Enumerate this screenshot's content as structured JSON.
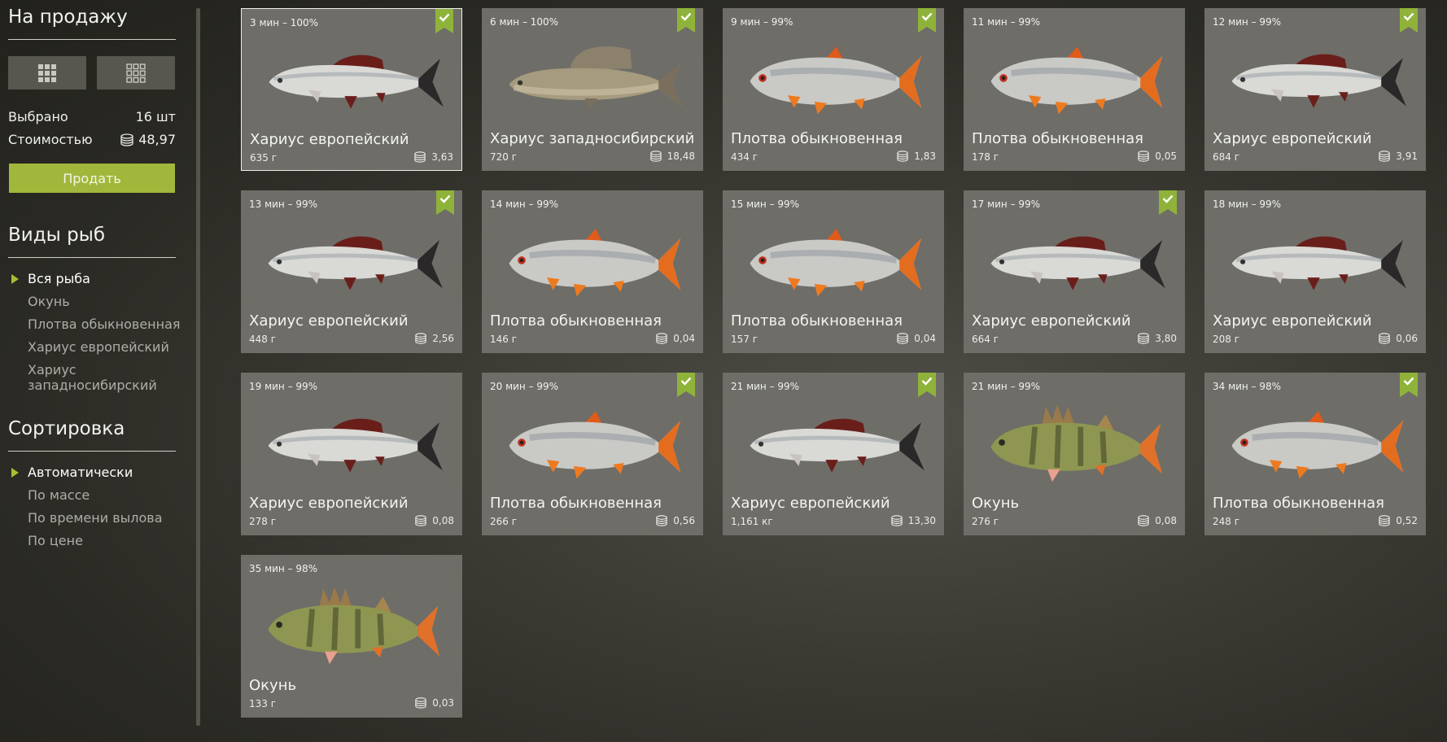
{
  "sidebar": {
    "title": "На продажу",
    "selected_label": "Выбрано",
    "selected_value": "16 шт",
    "cost_label": "Стоимостью",
    "cost_value": "48,97",
    "sell_label": "Продать",
    "species_title": "Виды рыб",
    "species": [
      "Вся рыба",
      "Окунь",
      "Плотва обыкновенная",
      "Хариус европейский",
      "Хариус западносибирский"
    ],
    "sort_title": "Сортировка",
    "sort": [
      "Автоматически",
      "По массе",
      "По времени вылова",
      "По цене"
    ]
  },
  "colors": {
    "accent": "#a1b73c",
    "card": "#6e6d68"
  },
  "cards": [
    {
      "time": "3 мин – 100%",
      "name": "Хариус европейский",
      "weight": "635 г",
      "price": "3,63",
      "fish": "grayling-eu",
      "checked": true,
      "selected": true
    },
    {
      "time": "6 мин – 100%",
      "name": "Хариус западносибирский",
      "weight": "720 г",
      "price": "18,48",
      "fish": "grayling-ws",
      "checked": true,
      "selected": false
    },
    {
      "time": "9 мин – 99%",
      "name": "Плотва обыкновенная",
      "weight": "434 г",
      "price": "1,83",
      "fish": "roach",
      "checked": true,
      "selected": false
    },
    {
      "time": "11 мин – 99%",
      "name": "Плотва обыкновенная",
      "weight": "178 г",
      "price": "0,05",
      "fish": "roach",
      "checked": false,
      "selected": false
    },
    {
      "time": "12 мин – 99%",
      "name": "Хариус европейский",
      "weight": "684 г",
      "price": "3,91",
      "fish": "grayling-eu",
      "checked": true,
      "selected": false
    },
    {
      "time": "13 мин – 99%",
      "name": "Хариус европейский",
      "weight": "448 г",
      "price": "2,56",
      "fish": "grayling-eu",
      "checked": true,
      "selected": false
    },
    {
      "time": "14 мин – 99%",
      "name": "Плотва обыкновенная",
      "weight": "146 г",
      "price": "0,04",
      "fish": "roach",
      "checked": false,
      "selected": false
    },
    {
      "time": "15 мин – 99%",
      "name": "Плотва обыкновенная",
      "weight": "157 г",
      "price": "0,04",
      "fish": "roach",
      "checked": false,
      "selected": false
    },
    {
      "time": "17 мин – 99%",
      "name": "Хариус европейский",
      "weight": "664 г",
      "price": "3,80",
      "fish": "grayling-eu",
      "checked": true,
      "selected": false
    },
    {
      "time": "18 мин – 99%",
      "name": "Хариус европейский",
      "weight": "208 г",
      "price": "0,06",
      "fish": "grayling-eu",
      "checked": false,
      "selected": false
    },
    {
      "time": "19 мин – 99%",
      "name": "Хариус европейский",
      "weight": "278 г",
      "price": "0,08",
      "fish": "grayling-eu",
      "checked": false,
      "selected": false
    },
    {
      "time": "20 мин – 99%",
      "name": "Плотва обыкновенная",
      "weight": "266 г",
      "price": "0,56",
      "fish": "roach",
      "checked": true,
      "selected": false
    },
    {
      "time": "21 мин – 99%",
      "name": "Хариус европейский",
      "weight": "1,161 кг",
      "price": "13,30",
      "fish": "grayling-eu",
      "checked": true,
      "selected": false
    },
    {
      "time": "21 мин – 99%",
      "name": "Окунь",
      "weight": "276 г",
      "price": "0,08",
      "fish": "perch",
      "checked": false,
      "selected": false
    },
    {
      "time": "34 мин – 98%",
      "name": "Плотва обыкновенная",
      "weight": "248 г",
      "price": "0,52",
      "fish": "roach",
      "checked": true,
      "selected": false
    },
    {
      "time": "35 мин – 98%",
      "name": "Окунь",
      "weight": "133 г",
      "price": "0,03",
      "fish": "perch",
      "checked": false,
      "selected": false
    }
  ]
}
